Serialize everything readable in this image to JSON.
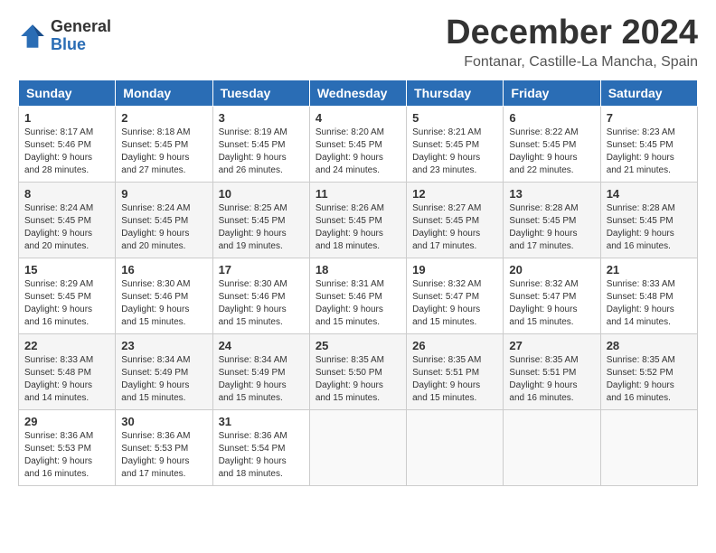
{
  "logo": {
    "general": "General",
    "blue": "Blue"
  },
  "header": {
    "month": "December 2024",
    "location": "Fontanar, Castille-La Mancha, Spain"
  },
  "days_of_week": [
    "Sunday",
    "Monday",
    "Tuesday",
    "Wednesday",
    "Thursday",
    "Friday",
    "Saturday"
  ],
  "weeks": [
    [
      {
        "day": "1",
        "sunrise": "8:17 AM",
        "sunset": "5:46 PM",
        "daylight": "9 hours and 28 minutes."
      },
      {
        "day": "2",
        "sunrise": "8:18 AM",
        "sunset": "5:45 PM",
        "daylight": "9 hours and 27 minutes."
      },
      {
        "day": "3",
        "sunrise": "8:19 AM",
        "sunset": "5:45 PM",
        "daylight": "9 hours and 26 minutes."
      },
      {
        "day": "4",
        "sunrise": "8:20 AM",
        "sunset": "5:45 PM",
        "daylight": "9 hours and 24 minutes."
      },
      {
        "day": "5",
        "sunrise": "8:21 AM",
        "sunset": "5:45 PM",
        "daylight": "9 hours and 23 minutes."
      },
      {
        "day": "6",
        "sunrise": "8:22 AM",
        "sunset": "5:45 PM",
        "daylight": "9 hours and 22 minutes."
      },
      {
        "day": "7",
        "sunrise": "8:23 AM",
        "sunset": "5:45 PM",
        "daylight": "9 hours and 21 minutes."
      }
    ],
    [
      {
        "day": "8",
        "sunrise": "8:24 AM",
        "sunset": "5:45 PM",
        "daylight": "9 hours and 20 minutes."
      },
      {
        "day": "9",
        "sunrise": "8:24 AM",
        "sunset": "5:45 PM",
        "daylight": "9 hours and 20 minutes."
      },
      {
        "day": "10",
        "sunrise": "8:25 AM",
        "sunset": "5:45 PM",
        "daylight": "9 hours and 19 minutes."
      },
      {
        "day": "11",
        "sunrise": "8:26 AM",
        "sunset": "5:45 PM",
        "daylight": "9 hours and 18 minutes."
      },
      {
        "day": "12",
        "sunrise": "8:27 AM",
        "sunset": "5:45 PM",
        "daylight": "9 hours and 17 minutes."
      },
      {
        "day": "13",
        "sunrise": "8:28 AM",
        "sunset": "5:45 PM",
        "daylight": "9 hours and 17 minutes."
      },
      {
        "day": "14",
        "sunrise": "8:28 AM",
        "sunset": "5:45 PM",
        "daylight": "9 hours and 16 minutes."
      }
    ],
    [
      {
        "day": "15",
        "sunrise": "8:29 AM",
        "sunset": "5:45 PM",
        "daylight": "9 hours and 16 minutes."
      },
      {
        "day": "16",
        "sunrise": "8:30 AM",
        "sunset": "5:46 PM",
        "daylight": "9 hours and 15 minutes."
      },
      {
        "day": "17",
        "sunrise": "8:30 AM",
        "sunset": "5:46 PM",
        "daylight": "9 hours and 15 minutes."
      },
      {
        "day": "18",
        "sunrise": "8:31 AM",
        "sunset": "5:46 PM",
        "daylight": "9 hours and 15 minutes."
      },
      {
        "day": "19",
        "sunrise": "8:32 AM",
        "sunset": "5:47 PM",
        "daylight": "9 hours and 15 minutes."
      },
      {
        "day": "20",
        "sunrise": "8:32 AM",
        "sunset": "5:47 PM",
        "daylight": "9 hours and 15 minutes."
      },
      {
        "day": "21",
        "sunrise": "8:33 AM",
        "sunset": "5:48 PM",
        "daylight": "9 hours and 14 minutes."
      }
    ],
    [
      {
        "day": "22",
        "sunrise": "8:33 AM",
        "sunset": "5:48 PM",
        "daylight": "9 hours and 14 minutes."
      },
      {
        "day": "23",
        "sunrise": "8:34 AM",
        "sunset": "5:49 PM",
        "daylight": "9 hours and 15 minutes."
      },
      {
        "day": "24",
        "sunrise": "8:34 AM",
        "sunset": "5:49 PM",
        "daylight": "9 hours and 15 minutes."
      },
      {
        "day": "25",
        "sunrise": "8:35 AM",
        "sunset": "5:50 PM",
        "daylight": "9 hours and 15 minutes."
      },
      {
        "day": "26",
        "sunrise": "8:35 AM",
        "sunset": "5:51 PM",
        "daylight": "9 hours and 15 minutes."
      },
      {
        "day": "27",
        "sunrise": "8:35 AM",
        "sunset": "5:51 PM",
        "daylight": "9 hours and 16 minutes."
      },
      {
        "day": "28",
        "sunrise": "8:35 AM",
        "sunset": "5:52 PM",
        "daylight": "9 hours and 16 minutes."
      }
    ],
    [
      {
        "day": "29",
        "sunrise": "8:36 AM",
        "sunset": "5:53 PM",
        "daylight": "9 hours and 16 minutes."
      },
      {
        "day": "30",
        "sunrise": "8:36 AM",
        "sunset": "5:53 PM",
        "daylight": "9 hours and 17 minutes."
      },
      {
        "day": "31",
        "sunrise": "8:36 AM",
        "sunset": "5:54 PM",
        "daylight": "9 hours and 18 minutes."
      },
      null,
      null,
      null,
      null
    ]
  ]
}
